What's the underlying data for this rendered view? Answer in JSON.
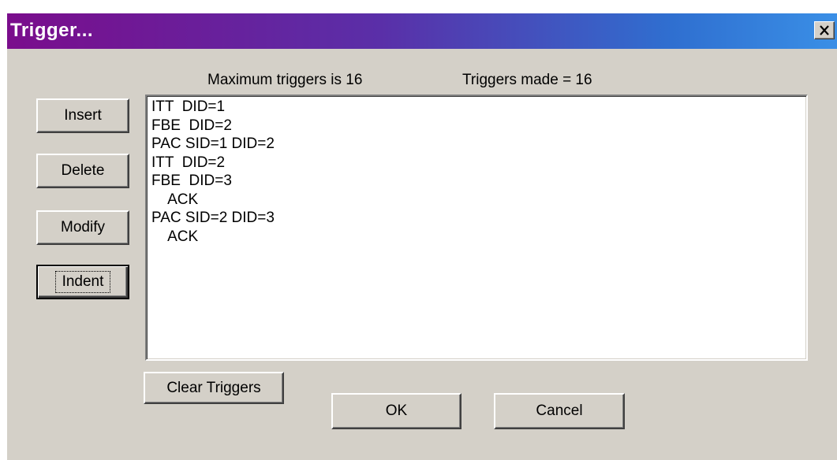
{
  "window": {
    "title": "Trigger...",
    "close_glyph": "×"
  },
  "info": {
    "max_triggers": "Maximum triggers is 16",
    "triggers_made": "Triggers made = 16"
  },
  "buttons": {
    "insert": "Insert",
    "delete": "Delete",
    "modify": "Modify",
    "indent": "Indent",
    "clear_triggers": "Clear Triggers",
    "ok": "OK",
    "cancel": "Cancel"
  },
  "trigger_list": {
    "items": [
      "ITT  DID=1",
      "FBE  DID=2",
      "PAC SID=1 DID=2",
      "ITT  DID=2",
      "FBE  DID=3",
      "    ACK",
      "PAC SID=2 DID=3",
      "    ACK"
    ]
  },
  "icons": {
    "close": "close-icon"
  },
  "colors": {
    "dialog_face": "#d4d0c8",
    "titlebar_start": "#7a0d8c",
    "titlebar_end": "#3a8fe6",
    "title_text": "#ffffff",
    "list_background": "#ffffff"
  }
}
